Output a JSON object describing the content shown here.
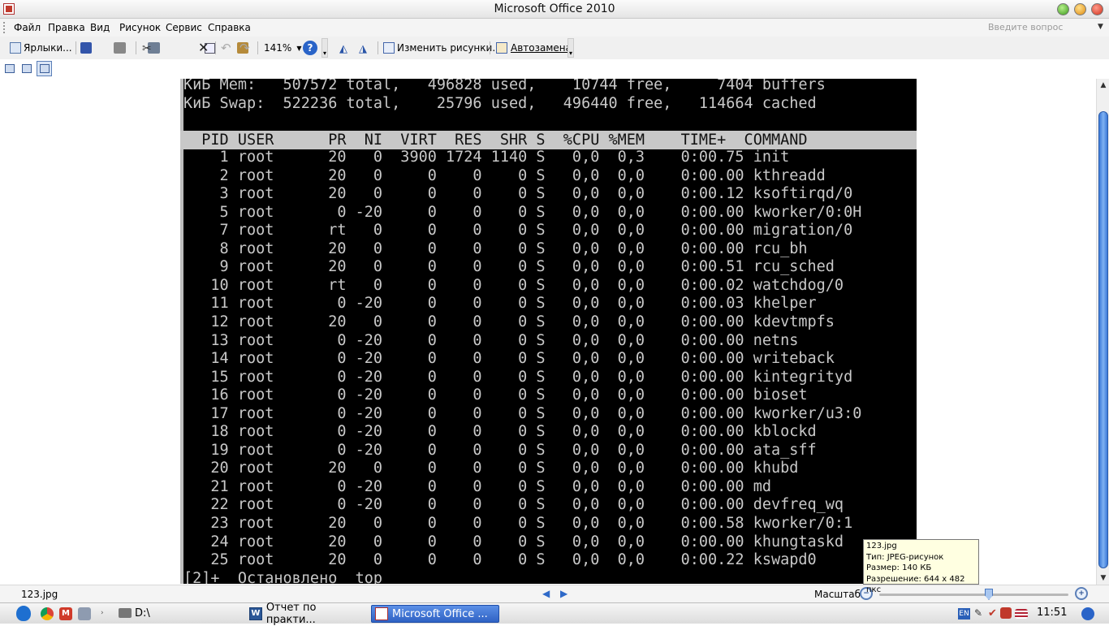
{
  "window": {
    "title": "Microsoft Office 2010"
  },
  "menu": {
    "items": [
      "Файл",
      "Правка",
      "Вид",
      "Рисунок",
      "Сервис",
      "Справка"
    ],
    "question_placeholder": "Введите вопрос"
  },
  "toolbar": {
    "shortcuts_label": "Ярлыки...",
    "zoom_value": "141%",
    "edit_pictures_label": "Изменить рисунки...",
    "autocorrect_label": "Автозамена"
  },
  "terminal": {
    "summary_lines": [
      "КиБ Mem:   507572 total,   496828 used,    10744 free,     7404 buffers",
      "КиБ Swap:  522236 total,    25796 used,   496440 free,   114664 cached"
    ],
    "header": "  PID USER      PR  NI  VIRT  RES  SHR S  %CPU %MEM    TIME+  COMMAND",
    "processes": [
      {
        "pid": "1",
        "user": "root",
        "pr": "20",
        "ni": "0",
        "virt": "3900",
        "res": "1724",
        "shr": "1140",
        "s": "S",
        "cpu": "0,0",
        "mem": "0,3",
        "time": "0:00.75",
        "command": "init"
      },
      {
        "pid": "2",
        "user": "root",
        "pr": "20",
        "ni": "0",
        "virt": "0",
        "res": "0",
        "shr": "0",
        "s": "S",
        "cpu": "0,0",
        "mem": "0,0",
        "time": "0:00.00",
        "command": "kthreadd"
      },
      {
        "pid": "3",
        "user": "root",
        "pr": "20",
        "ni": "0",
        "virt": "0",
        "res": "0",
        "shr": "0",
        "s": "S",
        "cpu": "0,0",
        "mem": "0,0",
        "time": "0:00.12",
        "command": "ksoftirqd/0"
      },
      {
        "pid": "5",
        "user": "root",
        "pr": "0",
        "ni": "-20",
        "virt": "0",
        "res": "0",
        "shr": "0",
        "s": "S",
        "cpu": "0,0",
        "mem": "0,0",
        "time": "0:00.00",
        "command": "kworker/0:0H"
      },
      {
        "pid": "7",
        "user": "root",
        "pr": "rt",
        "ni": "0",
        "virt": "0",
        "res": "0",
        "shr": "0",
        "s": "S",
        "cpu": "0,0",
        "mem": "0,0",
        "time": "0:00.00",
        "command": "migration/0"
      },
      {
        "pid": "8",
        "user": "root",
        "pr": "20",
        "ni": "0",
        "virt": "0",
        "res": "0",
        "shr": "0",
        "s": "S",
        "cpu": "0,0",
        "mem": "0,0",
        "time": "0:00.00",
        "command": "rcu_bh"
      },
      {
        "pid": "9",
        "user": "root",
        "pr": "20",
        "ni": "0",
        "virt": "0",
        "res": "0",
        "shr": "0",
        "s": "S",
        "cpu": "0,0",
        "mem": "0,0",
        "time": "0:00.51",
        "command": "rcu_sched"
      },
      {
        "pid": "10",
        "user": "root",
        "pr": "rt",
        "ni": "0",
        "virt": "0",
        "res": "0",
        "shr": "0",
        "s": "S",
        "cpu": "0,0",
        "mem": "0,0",
        "time": "0:00.02",
        "command": "watchdog/0"
      },
      {
        "pid": "11",
        "user": "root",
        "pr": "0",
        "ni": "-20",
        "virt": "0",
        "res": "0",
        "shr": "0",
        "s": "S",
        "cpu": "0,0",
        "mem": "0,0",
        "time": "0:00.03",
        "command": "khelper"
      },
      {
        "pid": "12",
        "user": "root",
        "pr": "20",
        "ni": "0",
        "virt": "0",
        "res": "0",
        "shr": "0",
        "s": "S",
        "cpu": "0,0",
        "mem": "0,0",
        "time": "0:00.00",
        "command": "kdevtmpfs"
      },
      {
        "pid": "13",
        "user": "root",
        "pr": "0",
        "ni": "-20",
        "virt": "0",
        "res": "0",
        "shr": "0",
        "s": "S",
        "cpu": "0,0",
        "mem": "0,0",
        "time": "0:00.00",
        "command": "netns"
      },
      {
        "pid": "14",
        "user": "root",
        "pr": "0",
        "ni": "-20",
        "virt": "0",
        "res": "0",
        "shr": "0",
        "s": "S",
        "cpu": "0,0",
        "mem": "0,0",
        "time": "0:00.00",
        "command": "writeback"
      },
      {
        "pid": "15",
        "user": "root",
        "pr": "0",
        "ni": "-20",
        "virt": "0",
        "res": "0",
        "shr": "0",
        "s": "S",
        "cpu": "0,0",
        "mem": "0,0",
        "time": "0:00.00",
        "command": "kintegrityd"
      },
      {
        "pid": "16",
        "user": "root",
        "pr": "0",
        "ni": "-20",
        "virt": "0",
        "res": "0",
        "shr": "0",
        "s": "S",
        "cpu": "0,0",
        "mem": "0,0",
        "time": "0:00.00",
        "command": "bioset"
      },
      {
        "pid": "17",
        "user": "root",
        "pr": "0",
        "ni": "-20",
        "virt": "0",
        "res": "0",
        "shr": "0",
        "s": "S",
        "cpu": "0,0",
        "mem": "0,0",
        "time": "0:00.00",
        "command": "kworker/u3:0"
      },
      {
        "pid": "18",
        "user": "root",
        "pr": "0",
        "ni": "-20",
        "virt": "0",
        "res": "0",
        "shr": "0",
        "s": "S",
        "cpu": "0,0",
        "mem": "0,0",
        "time": "0:00.00",
        "command": "kblockd"
      },
      {
        "pid": "19",
        "user": "root",
        "pr": "0",
        "ni": "-20",
        "virt": "0",
        "res": "0",
        "shr": "0",
        "s": "S",
        "cpu": "0,0",
        "mem": "0,0",
        "time": "0:00.00",
        "command": "ata_sff"
      },
      {
        "pid": "20",
        "user": "root",
        "pr": "20",
        "ni": "0",
        "virt": "0",
        "res": "0",
        "shr": "0",
        "s": "S",
        "cpu": "0,0",
        "mem": "0,0",
        "time": "0:00.00",
        "command": "khubd"
      },
      {
        "pid": "21",
        "user": "root",
        "pr": "0",
        "ni": "-20",
        "virt": "0",
        "res": "0",
        "shr": "0",
        "s": "S",
        "cpu": "0,0",
        "mem": "0,0",
        "time": "0:00.00",
        "command": "md"
      },
      {
        "pid": "22",
        "user": "root",
        "pr": "0",
        "ni": "-20",
        "virt": "0",
        "res": "0",
        "shr": "0",
        "s": "S",
        "cpu": "0,0",
        "mem": "0,0",
        "time": "0:00.00",
        "command": "devfreq_wq"
      },
      {
        "pid": "23",
        "user": "root",
        "pr": "20",
        "ni": "0",
        "virt": "0",
        "res": "0",
        "shr": "0",
        "s": "S",
        "cpu": "0,0",
        "mem": "0,0",
        "time": "0:00.58",
        "command": "kworker/0:1"
      },
      {
        "pid": "24",
        "user": "root",
        "pr": "20",
        "ni": "0",
        "virt": "0",
        "res": "0",
        "shr": "0",
        "s": "S",
        "cpu": "0,0",
        "mem": "0,0",
        "time": "0:00.00",
        "command": "khungtaskd"
      },
      {
        "pid": "25",
        "user": "root",
        "pr": "20",
        "ni": "0",
        "virt": "0",
        "res": "0",
        "shr": "0",
        "s": "S",
        "cpu": "0,0",
        "mem": "0,0",
        "time": "0:00.22",
        "command": "kswapd0"
      }
    ],
    "footer_line": "[2]+  Остановлено  top"
  },
  "status": {
    "filename": "123.jpg",
    "zoom_label": "Масштаб:",
    "zoom_level_fraction": 0.56
  },
  "tooltip": {
    "lines": [
      "123.jpg",
      "Тип: JPEG-рисунок",
      "Размер: 140 КБ",
      "Разрешение: 644 x 482 пкс"
    ]
  },
  "taskbar": {
    "drive_label": "D:\\",
    "tasks": [
      {
        "label": "Отчет по практи...",
        "active": false,
        "icon": "word-icon"
      },
      {
        "label": "Microsoft Office ...",
        "active": true,
        "icon": "office-picture-icon"
      }
    ],
    "lang": "EN",
    "clock": "11:51"
  }
}
